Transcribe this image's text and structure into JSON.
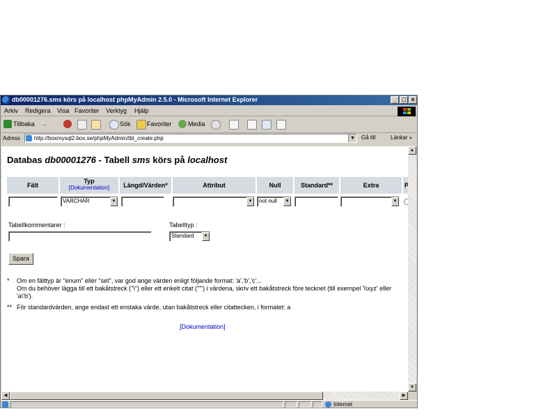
{
  "window": {
    "title": "db00001276.sms körs på localhost  phpMyAdmin 2.5.0 - Microsoft Internet Explorer",
    "btn_min": "_",
    "btn_max": "□",
    "btn_close": "×"
  },
  "menu": [
    "Arkiv",
    "Redigera",
    "Visa",
    "Favoriter",
    "Verktyg",
    "Hjälp"
  ],
  "toolbar": {
    "back": "Tillbaka",
    "forward": "→",
    "search": "Sök",
    "favorites": "Favoriter",
    "media": "Media"
  },
  "address": {
    "label": "Adress",
    "url": "http://boxmysql2.box.se/phpMyAdmin/tbl_create.php",
    "go": "Gå till",
    "links": "Länkar »"
  },
  "page": {
    "heading_prefix": "Databas ",
    "db_name": "db00001276",
    "heading_mid": " - Tabell ",
    "table_name": "sms",
    "heading_mid2": " körs på ",
    "host": "localhost",
    "columns": {
      "field": "Fält",
      "type": "Typ",
      "type_doc": "[Dokumentation]",
      "length": "Längd/Värden*",
      "attributes": "Attribut",
      "null": "Null",
      "default": "Standard**",
      "extra": "Extra",
      "primary": "P"
    },
    "row": {
      "field_value": "",
      "type_value": "VARCHAR",
      "length_value": "",
      "attributes_value": "",
      "null_value": "not null",
      "default_value": "",
      "extra_value": ""
    },
    "table_comment_label": "Tabellkommentarer :",
    "table_comment_value": "",
    "table_type_label": "Tabelltyp :",
    "table_type_value": "Standard",
    "save_label": "Spara",
    "note1_mark": "*",
    "note1_line1": "Om en fälttyp är \"enum\" eller \"set\", var god ange värden enligt följande format: 'a','b','c'...",
    "note1_line2": "Om du behöver lägga till ett bakåtstreck (\"\\\") eller ett enkelt citat (\"'\") i värdena, skriv ett bakåtstreck före tecknet (till exempel '\\\\xyz' eller 'a\\'b').",
    "note2_mark": "**",
    "note2_text": "För standardvärden, ange endast ett enstaka värde, utan bakåtstreck eller citattecken, i formatet: a",
    "doc_link": "[Dokumentation]"
  },
  "status": {
    "zone": "Internet"
  },
  "colors": {
    "title_start": "#0a246a",
    "title_end": "#3a6ea5",
    "table_header": "#d5dbe1",
    "link": "#0000cc"
  }
}
